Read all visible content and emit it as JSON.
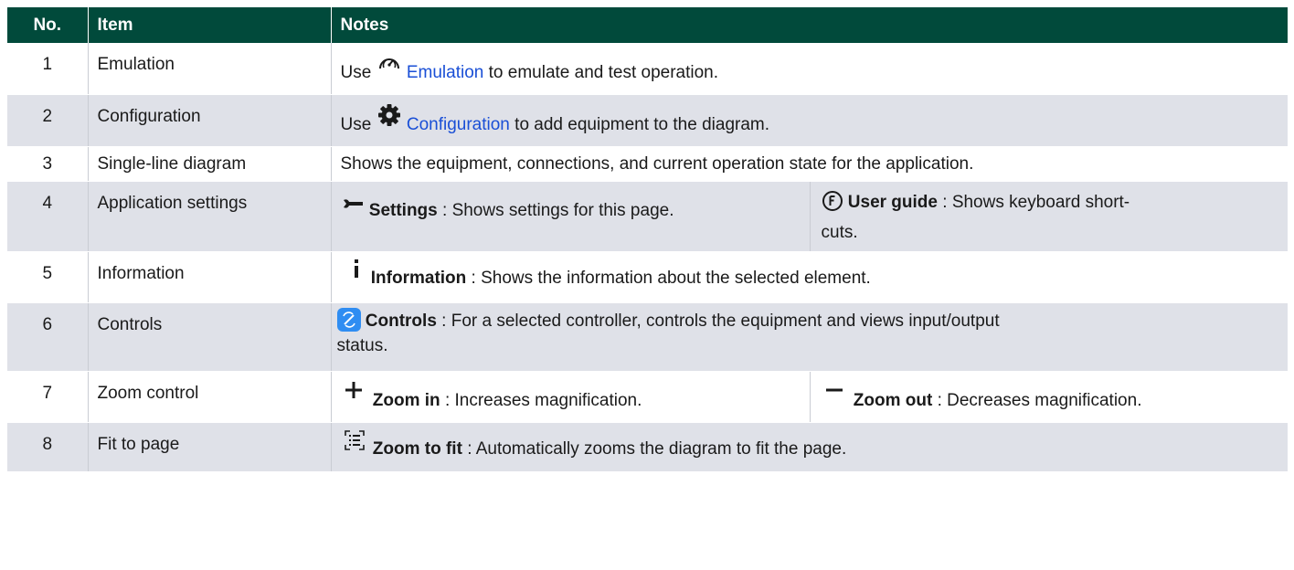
{
  "headers": {
    "no": "No.",
    "item": "Item",
    "notes": "Notes"
  },
  "rows": [
    {
      "no": "1",
      "item": "Emulation",
      "use": "Use",
      "link": "Emulation",
      "rest": "to emulate and test operation.",
      "icon": "gauge-icon"
    },
    {
      "no": "2",
      "item": "Configuration",
      "use": "Use",
      "link": "Configuration",
      "rest": "to add equipment to the diagram.",
      "icon": "gear-icon"
    },
    {
      "no": "3",
      "item": "Single-line diagram",
      "text": "Shows the equipment, connections, and current operation state for the application."
    },
    {
      "no": "4",
      "item": "Application settings",
      "left": {
        "bold": "Settings",
        "rest": " : Shows settings for this page.",
        "icon": "wrench-icon"
      },
      "right": {
        "bold": "User guide",
        "rest": " : Shows keyboard short-",
        "rest2": "cuts.",
        "icon": "user-guide-icon"
      }
    },
    {
      "no": "5",
      "item": "Information",
      "bold": "Information",
      "rest": " : Shows the information about the selected element.",
      "icon": "info-icon"
    },
    {
      "no": "6",
      "item": "Controls",
      "bold": "Controls",
      "rest": " : For a selected controller, controls the equipment and views input/output",
      "rest2": "status.",
      "icon": "controls-icon",
      "icon_color": "#2f8df2"
    },
    {
      "no": "7",
      "item": "Zoom control",
      "left": {
        "bold": "Zoom in",
        "rest": " : Increases magnification.",
        "icon": "plus-icon"
      },
      "right": {
        "bold": "Zoom out",
        "rest": " : Decreases magnification.",
        "icon": "minus-icon"
      }
    },
    {
      "no": "8",
      "item": "Fit to page",
      "bold": "Zoom to fit",
      "rest": " : Automatically zooms the diagram to fit the page.",
      "icon": "fit-page-icon"
    }
  ],
  "colors": {
    "header_bg": "#014a3b",
    "stripe": "#dfe1e8",
    "link": "#1a4fd6"
  }
}
